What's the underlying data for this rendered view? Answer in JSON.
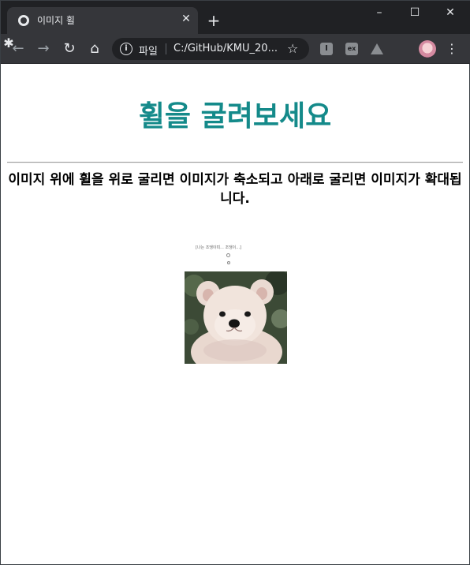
{
  "browser": {
    "tab_title": "이미지 휠",
    "tab_close": "✕",
    "new_tab": "+",
    "window_controls": {
      "minimize": "–",
      "maximize": "☐",
      "close": "✕"
    },
    "toolbar": {
      "back": "←",
      "forward": "→",
      "reload": "↻",
      "home": "⌂"
    },
    "omnibox": {
      "info": "i",
      "scheme_label": "파일",
      "url": "C:/GitHub/KMU_20...",
      "star": "☆"
    },
    "extensions": {
      "ext1": "I",
      "ext2": "ex",
      "puzzle": "✱",
      "menu": "⋮"
    }
  },
  "page": {
    "title": "휠을 굴려보세요",
    "description": "이미지 위에 휠을 위로 굴리면 이미지가 축소되고 아래로 굴리면 이미지가 확대됩니다.",
    "image_caption": "[나는 조댕이띠... 조댕이...]"
  },
  "colors": {
    "title": "#148a8a",
    "tabstrip_bg": "#202124",
    "toolbar_bg": "#35363a"
  },
  "icons": {
    "favicon": "globe-icon",
    "info": "info-icon",
    "star": "star-icon",
    "puzzle": "puzzle-icon"
  }
}
